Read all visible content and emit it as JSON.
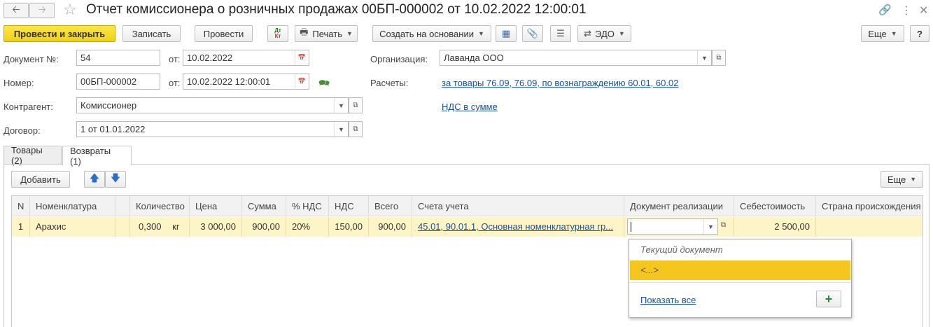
{
  "window": {
    "title": "Отчет комиссионера о розничных продажах 00БП-000002 от 10.02.2022 12:00:01",
    "back_icon": "arrow-left-icon",
    "forward_icon": "arrow-right-icon",
    "favorite_icon": "star-icon"
  },
  "toolbar": {
    "post_close": "Провести и закрыть",
    "save": "Записать",
    "post": "Провести",
    "dtkt_top": "Дт",
    "dtkt_bottom": "Кт",
    "print": "Печать",
    "create_based": "Создать на основании",
    "edo": "ЭДО",
    "more": "Еще",
    "help": "?"
  },
  "form": {
    "doc_label": "Документ №:",
    "doc_value": "54",
    "from_label": "от:",
    "doc_date": "10.02.2022",
    "number_label": "Номер:",
    "number_value": "00БП-000002",
    "from_label2": "от:",
    "number_datetime": "10.02.2022 12:00:01",
    "contractor_label": "Контрагент:",
    "contractor_value": "Комиссионер",
    "contract_label": "Договор:",
    "contract_value": "1 от 01.01.2022",
    "org_label": "Организация:",
    "org_value": "Лаванда ООО",
    "settlements_label": "Расчеты:",
    "settlements_link": "за товары 76.09, 76.09, по вознаграждению 60.01, 60.02",
    "vat_link": "НДС в сумме"
  },
  "tabs": [
    {
      "label": "Товары (2)",
      "active": false
    },
    {
      "label": "Возвраты (1)",
      "active": true
    }
  ],
  "table_toolbar": {
    "add": "Добавить",
    "more": "Еще"
  },
  "table": {
    "columns": [
      "N",
      "Номенклатура",
      "",
      "Количество",
      "Цена",
      "Сумма",
      "% НДС",
      "НДС",
      "Всего",
      "Счета учета",
      "Документ реализации",
      "Себестоимость",
      "Страна происхождения"
    ],
    "rows": [
      {
        "n": "1",
        "item": "Арахис",
        "qty": "0,300",
        "unit": "кг",
        "price": "3 000,00",
        "sum": "900,00",
        "vat_rate": "20%",
        "vat": "150,00",
        "total": "900,00",
        "accounts": "45.01, 90.01.1, Основная номенклатурная гр...",
        "sale_doc": "",
        "cost": "2 500,00",
        "country": ""
      }
    ]
  },
  "dropdown": {
    "header": "Текущий документ",
    "selected": "<...>",
    "show_all": "Показать все",
    "add_icon": "plus-icon"
  },
  "colors": {
    "primary_button": "#f5d42a",
    "selected_row": "#fdf5c8",
    "link": "#1a4f9c"
  }
}
